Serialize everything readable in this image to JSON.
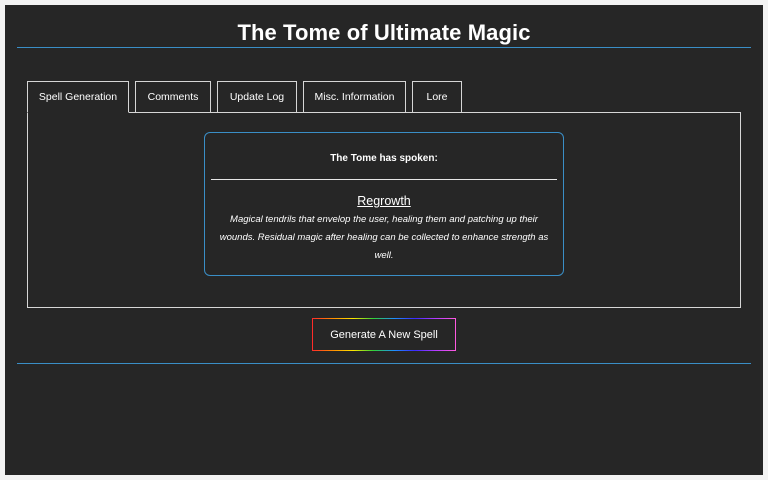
{
  "header": {
    "title": "The Tome of Ultimate Magic"
  },
  "tabs": [
    {
      "label": "Spell Generation",
      "active": true
    },
    {
      "label": "Comments",
      "active": false
    },
    {
      "label": "Update Log",
      "active": false
    },
    {
      "label": "Misc. Information",
      "active": false
    },
    {
      "label": "Lore",
      "active": false
    }
  ],
  "result": {
    "heading": "The Tome has spoken:",
    "spell_name": "Regrowth",
    "spell_description": "Magical tendrils that envelop the user, healing them and patching up their wounds. Residual magic after healing can be collected to enhance strength as well."
  },
  "actions": {
    "generate_label": "Generate A New Spell"
  },
  "colors": {
    "background": "#262626",
    "accent_rule": "#3a8ec6",
    "text": "#ffffff"
  }
}
